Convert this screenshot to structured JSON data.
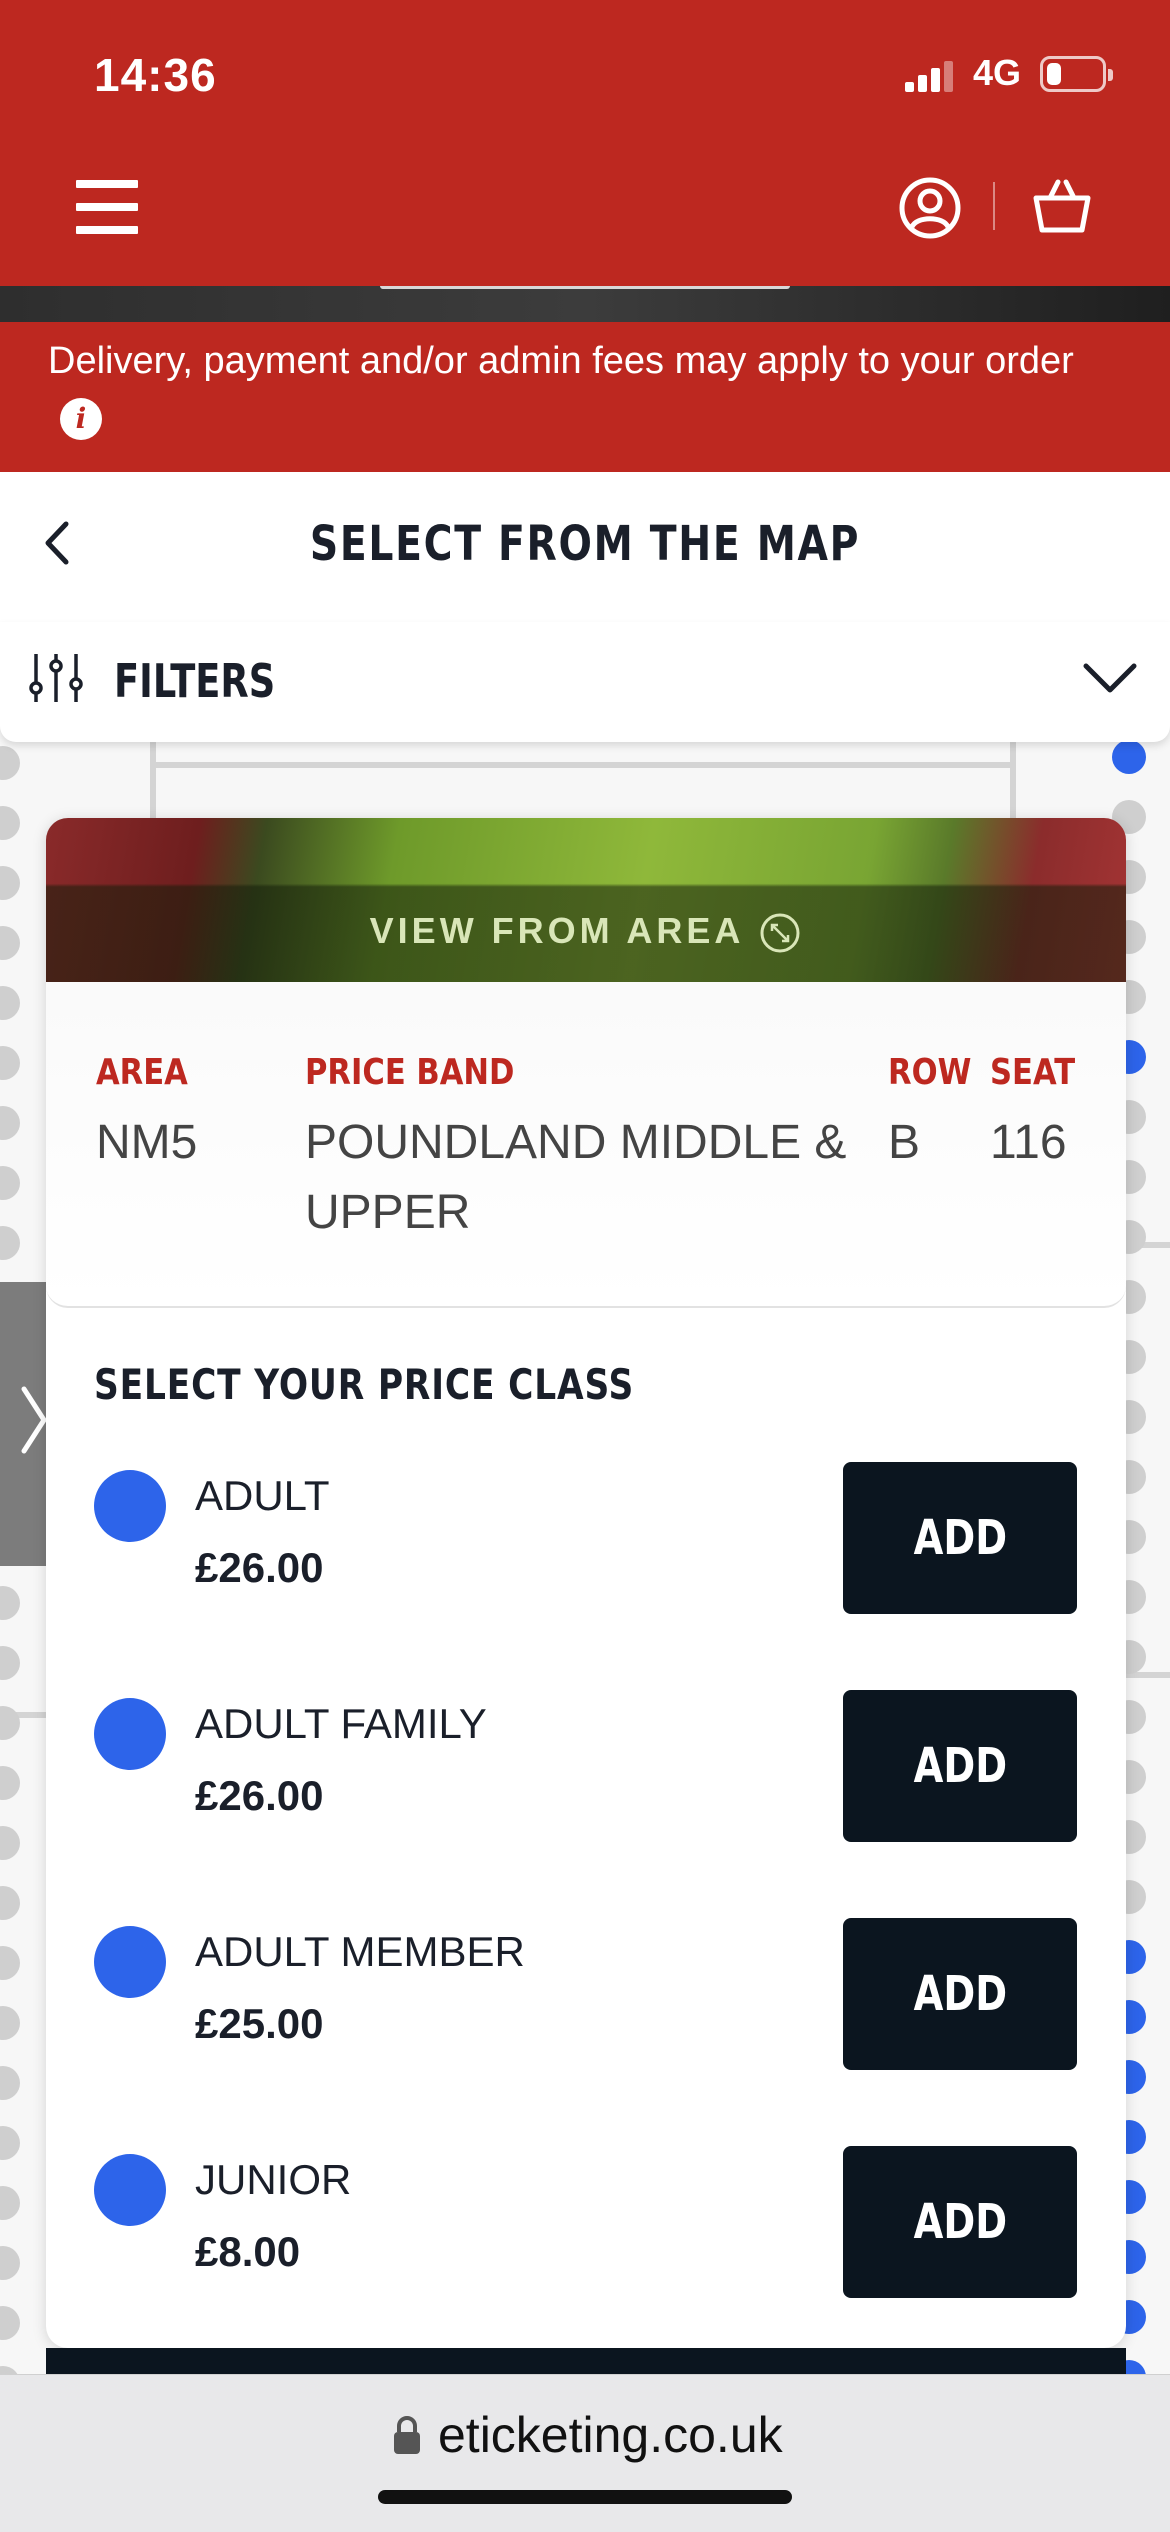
{
  "status_bar": {
    "time": "14:36",
    "network": "4G",
    "battery_percent": 25
  },
  "banner": {
    "text": "Delivery, payment and/or admin fees may apply to your order"
  },
  "page": {
    "title": "SELECT FROM THE MAP"
  },
  "filters": {
    "label": "FILTERS"
  },
  "seat_card": {
    "view_label": "VIEW FROM AREA",
    "area": {
      "label": "AREA",
      "value": "NM5"
    },
    "price_band": {
      "label": "PRICE BAND",
      "value_line1": "POUNDLAND MIDDLE &",
      "value_line2": "UPPER"
    },
    "row": {
      "label": "ROW",
      "value": "B"
    },
    "seat": {
      "label": "SEAT",
      "value": "116"
    },
    "price_heading": "SELECT YOUR PRICE CLASS",
    "price_classes": [
      {
        "name": "ADULT",
        "price": "£26.00",
        "button": "ADD"
      },
      {
        "name": "ADULT FAMILY",
        "price": "£26.00",
        "button": "ADD"
      },
      {
        "name": "ADULT MEMBER",
        "price": "£25.00",
        "button": "ADD"
      },
      {
        "name": "JUNIOR",
        "price": "£8.00",
        "button": "ADD"
      }
    ]
  },
  "browser": {
    "url": "eticketing.co.uk"
  },
  "colors": {
    "brand_red": "#bd2820",
    "button_dark": "#0b151f",
    "seat_blue": "#2d64ea",
    "seat_grey": "#cfcfcf"
  },
  "icons": [
    "menu-icon",
    "account-icon",
    "basket-icon",
    "info-icon",
    "back-icon",
    "filters-icon",
    "chevron-down-icon",
    "expand-icon",
    "chevron-right-icon",
    "lock-icon"
  ]
}
